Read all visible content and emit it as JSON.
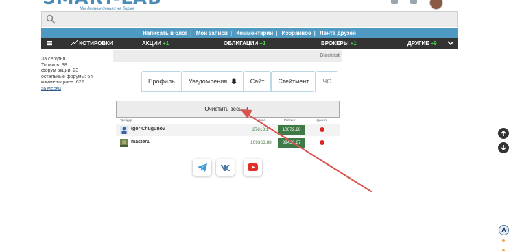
{
  "header": {
    "logo": "SMART-LAB",
    "tagline": "Мы делаем деньги на бирже"
  },
  "search": {
    "placeholder": ""
  },
  "top_nav": {
    "items": [
      "Написать в блог",
      "Мои записи",
      "Комментарии",
      "Избранное",
      "Лента друзей"
    ]
  },
  "market_nav": {
    "quotes": "КОТИРОВКИ",
    "stocks": "АКЦИИ",
    "stocks_badge": "+1",
    "bonds": "ОБЛИГАЦИИ",
    "bonds_badge": "+1",
    "brokers": "БРОКЕРЫ",
    "brokers_badge": "+1",
    "other": "ДРУГИЕ",
    "other_badge": "+9"
  },
  "stats": {
    "today": "За сегодня",
    "topics": "Топиков: 38",
    "stock_forum": "форум акций: 23",
    "other_forums": "остальные форумы: 64",
    "comments": "комментариев: 622",
    "month_link": "за месяц"
  },
  "blacklist_title": "Blacklist",
  "tabs": [
    "Профиль",
    "Уведомления",
    "Сайт",
    "Стейтмент",
    "ЧС"
  ],
  "clear_button": "Очистить весь ЧС",
  "table": {
    "headers": {
      "trader": "Трейдер",
      "karma": "Сила",
      "rating": "Рейтинг",
      "remove": "Удалить"
    },
    "rows": [
      {
        "name": "Igor Chugunov",
        "karma": "27618.1",
        "rating": "10072.20"
      },
      {
        "name": "master1",
        "karma": "109363.88",
        "rating": "39458.87"
      }
    ]
  },
  "social": [
    "telegram-icon",
    "vk-icon",
    "youtube-icon"
  ],
  "colors": {
    "nav_blue": "#4f9ac3",
    "nav_dark": "#333333",
    "rating_green": "#3d7a46",
    "annotation_red": "#d9534f"
  },
  "accessibility_badge": "A"
}
